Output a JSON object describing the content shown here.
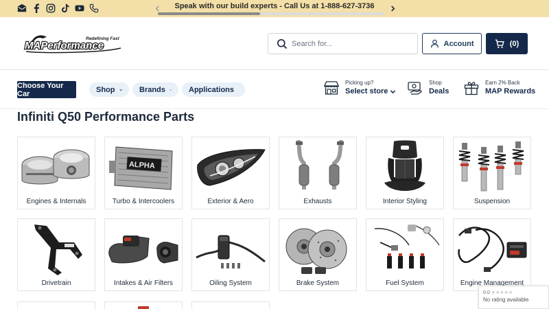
{
  "topbar": {
    "announcement": "Speak with our build experts - Call Us at 1-888-627-3736",
    "social_icons": [
      "email-icon",
      "facebook-icon",
      "instagram-icon",
      "tiktok-icon",
      "youtube-icon",
      "phone-icon"
    ],
    "carousel_progress": 0.45
  },
  "header": {
    "logo_text": "MAPerformance",
    "logo_tagline": "Redefining Fast",
    "search_placeholder": "Search for...",
    "account_label": "Account",
    "cart_label": "(0)"
  },
  "nav": {
    "choose_car": "Choose Your Car",
    "menus": [
      {
        "label": "Shop"
      },
      {
        "label": "Brands"
      },
      {
        "label": "Applications"
      }
    ],
    "store": {
      "small": "Picking up?",
      "big": "Select store"
    },
    "deals": {
      "small": "Shop",
      "big": "Deals"
    },
    "rewards": {
      "small": "Earn 2% Back",
      "big": "MAP Rewards"
    }
  },
  "page": {
    "title": "Infiniti Q50 Performance Parts"
  },
  "categories": [
    {
      "label": "Engines & Internals"
    },
    {
      "label": "Turbo & Intercoolers"
    },
    {
      "label": "Exterior & Aero"
    },
    {
      "label": "Exhausts"
    },
    {
      "label": "Interior Styling"
    },
    {
      "label": "Suspension"
    },
    {
      "label": "Drivetrain"
    },
    {
      "label": "Intakes & Air Filters"
    },
    {
      "label": "Oiling System"
    },
    {
      "label": "Brake System"
    },
    {
      "label": "Fuel System"
    },
    {
      "label": "Engine Management"
    }
  ],
  "rating_widget": {
    "score": "0.0",
    "text": "No rating available"
  },
  "colors": {
    "topbar_bg": "#f3e0a8",
    "navy": "#14294a",
    "pill_bg": "#e8f0f8"
  }
}
